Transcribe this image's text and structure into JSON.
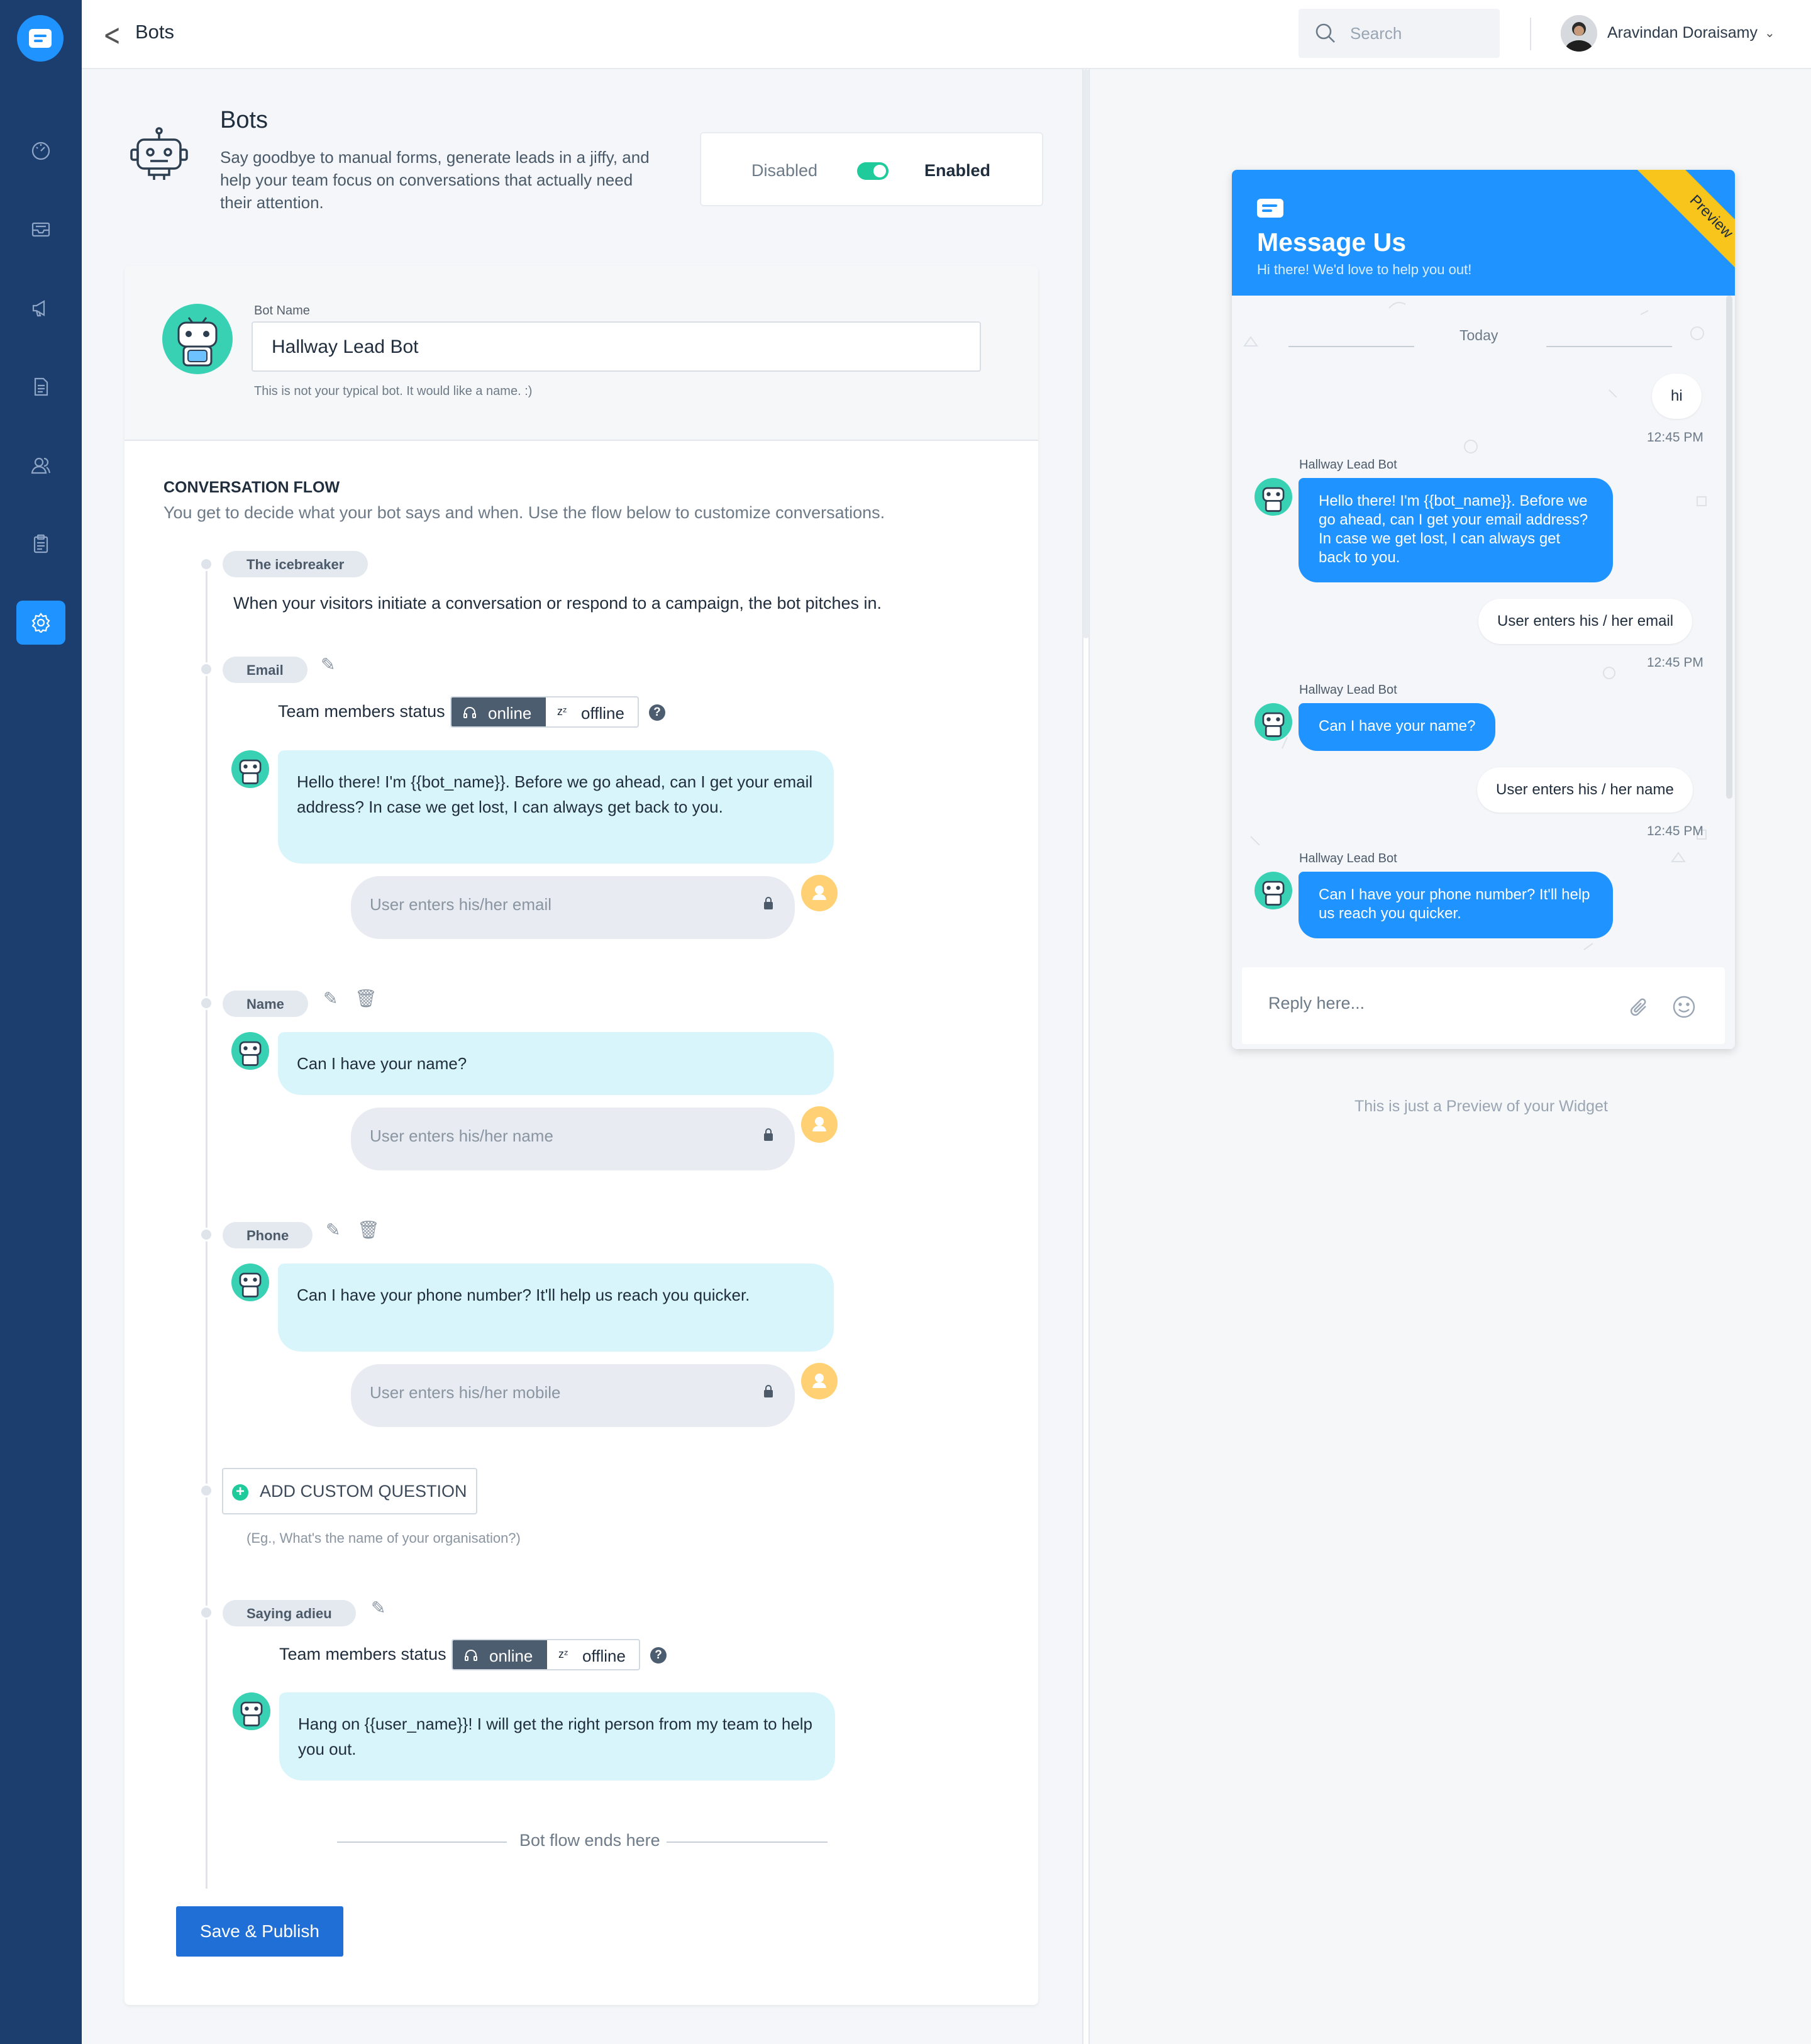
{
  "topbar": {
    "title": "Bots",
    "search_placeholder": "Search",
    "user_name": "Aravindan Doraisamy"
  },
  "sidebar": {
    "items": [
      {
        "icon": "dashboard-icon"
      },
      {
        "icon": "inbox-icon"
      },
      {
        "icon": "campaign-icon"
      },
      {
        "icon": "document-icon"
      },
      {
        "icon": "contacts-icon"
      },
      {
        "icon": "clipboard-icon"
      },
      {
        "icon": "settings-icon",
        "active": true
      }
    ]
  },
  "intro": {
    "title": "Bots",
    "description": "Say goodbye to manual forms, generate leads in a jiffy, and help your team focus on conversations that actually need their attention."
  },
  "status_toggle": {
    "disabled_label": "Disabled",
    "enabled_label": "Enabled",
    "enabled": true
  },
  "bot_name": {
    "label": "Bot Name",
    "value": "Hallway Lead Bot",
    "hint": "This is not your typical bot. It would like a name. :)"
  },
  "flow": {
    "heading": "CONVERSATION FLOW",
    "description": "You get to decide what your bot says and when. Use the flow below to customize conversations.",
    "icebreaker": {
      "label": "The icebreaker",
      "text": "When your visitors initiate a conversation or respond to a campaign, the bot pitches in."
    },
    "status_label": "Team members status",
    "online_label": "online",
    "offline_label": "offline",
    "steps": [
      {
        "label": "Email",
        "bot": "Hello there! I'm {{bot_name}}. Before we go ahead, can I get your email address? In case we get lost, I can always get back to you.",
        "user": "User enters his/her email"
      },
      {
        "label": "Name",
        "bot": "Can I have your name?",
        "user": "User enters his/her name"
      },
      {
        "label": "Phone",
        "bot": "Can I have your phone number? It'll help us reach you quicker.",
        "user": "User enters his/her mobile"
      }
    ],
    "add_question_label": "ADD CUSTOM QUESTION",
    "add_question_hint": "(Eg., What's the name of your organisation?)",
    "adieu": {
      "label": "Saying adieu",
      "bot": "Hang on {{user_name}}! I will get the right person from my team to help you out."
    },
    "end_text": "Bot flow ends here"
  },
  "save_button": "Save & Publish",
  "preview": {
    "title": "Message Us",
    "subtitle": "Hi there! We'd love to help you out!",
    "ribbon": "Preview",
    "today": "Today",
    "bot_name": "Hallway Lead Bot",
    "messages": {
      "user1": "hi",
      "time": "12:45 PM",
      "bot1": "Hello there! I'm {{bot_name}}. Before we go ahead, can I get your email address? In case we get lost, I can always get back to you.",
      "user2": "User enters his / her email",
      "bot2": "Can I have your name?",
      "user3": "User enters his / her name",
      "bot3": "Can I have your phone number? It'll help us reach you quicker."
    },
    "reply_placeholder": "Reply here...",
    "note": "This is just a Preview of your Widget"
  },
  "colors": {
    "brand": "#1f93ff",
    "sidebar": "#1b3e6e",
    "toggle_on": "#1fcb9a",
    "bot_bubble": "#d9f5fc",
    "save_button": "#1f6fd6",
    "ribbon": "#f8c51c"
  }
}
